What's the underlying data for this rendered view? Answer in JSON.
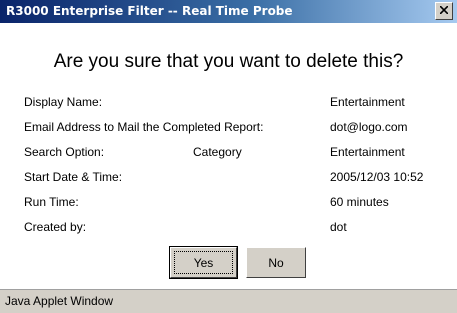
{
  "window": {
    "title": "R3000 Enterprise Filter -- Real Time Probe",
    "close_icon": "close-icon"
  },
  "dialog": {
    "question": "Are you sure that you want to delete this?",
    "rows": [
      {
        "label": "Display Name:",
        "middle": "",
        "value": "Entertainment"
      },
      {
        "label": "Email Address to Mail the Completed Report:",
        "middle": "",
        "value": "dot@logo.com"
      },
      {
        "label": "Search Option:",
        "middle": "Category",
        "value": "Entertainment"
      },
      {
        "label": "Start Date & Time:",
        "middle": "",
        "value": "2005/12/03 10:52"
      },
      {
        "label": "Run Time:",
        "middle": "",
        "value": "60 minutes"
      },
      {
        "label": "Created by:",
        "middle": "",
        "value": "dot"
      }
    ],
    "yes_label": "Yes",
    "no_label": "No"
  },
  "status": {
    "text": "Java Applet Window"
  }
}
